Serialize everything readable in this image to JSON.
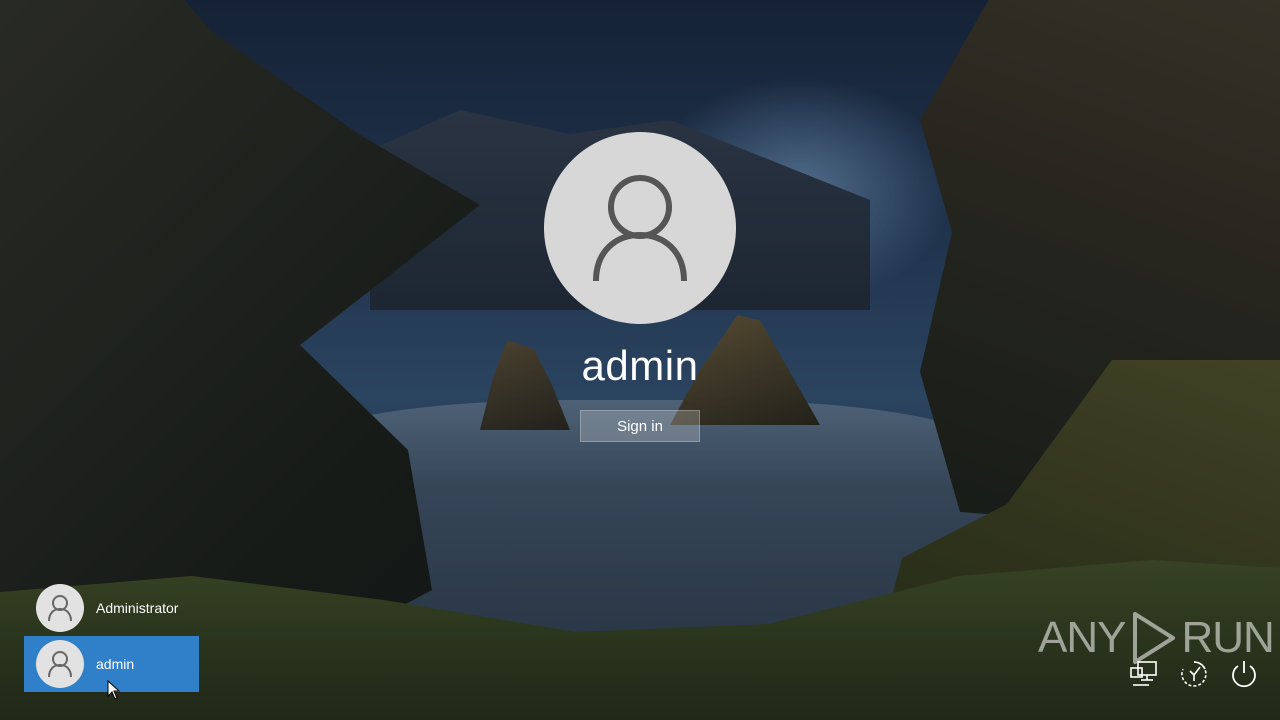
{
  "login": {
    "username": "admin",
    "signin_label": "Sign in",
    "avatar_icon": "user-icon"
  },
  "user_list": {
    "items": [
      {
        "label": "Administrator",
        "selected": false
      },
      {
        "label": "admin",
        "selected": true
      }
    ],
    "selected_color": "#2f7fc9"
  },
  "system_icons": [
    {
      "icon": "network-icon"
    },
    {
      "icon": "ease-of-access-icon"
    },
    {
      "icon": "power-icon"
    }
  ],
  "watermark": {
    "left_text": "ANY",
    "right_text": "RUN"
  }
}
